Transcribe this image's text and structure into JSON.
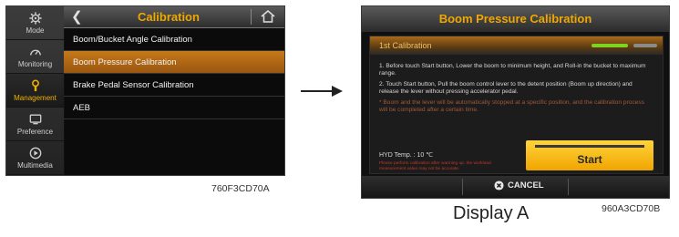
{
  "left": {
    "sidebar": [
      {
        "label": "Mode",
        "icon": "gear-icon",
        "active": false
      },
      {
        "label": "Monitoring",
        "icon": "gauge-icon",
        "active": false
      },
      {
        "label": "Management",
        "icon": "wrench-icon",
        "active": true
      },
      {
        "label": "Preference",
        "icon": "monitor-icon",
        "active": false
      },
      {
        "label": "Multimedia",
        "icon": "play-icon",
        "active": false
      }
    ],
    "header": {
      "title": "Calibration",
      "back_icon": "back-icon",
      "home_icon": "home-icon"
    },
    "menu": [
      {
        "label": "Boom/Bucket Angle Calibration",
        "selected": false
      },
      {
        "label": "Boom Pressure Calibration",
        "selected": true
      },
      {
        "label": "Brake Pedal Sensor Calibration",
        "selected": false
      },
      {
        "label": "AEB",
        "selected": false
      }
    ],
    "caption": "760F3CD70A"
  },
  "right": {
    "title": "Boom Pressure Calibration",
    "step_label": "1st Calibration",
    "progress": {
      "done": 1,
      "total": 2
    },
    "instructions": [
      "1. Before touch Start button, Lower the boom to minimum height, and Roll-in the bucket to maximum range.",
      "2. Touch Start button, Pull the boom control lever to the detent position (Boom up direction) and release the lever without pressing accelerator pedal.",
      "* Boom and the lever will be automatically stopped at a specific position, and the calibration process will be completed after a certain time."
    ],
    "hyd_temp": "HYD Temp. : 10 ℃",
    "warning": "Please perform calibration after warming up. the workload measurement value may not be accurate.",
    "start_label": "Start",
    "cancel_label": "CANCEL",
    "caption": "960A3CD70B",
    "display_label": "Display A"
  },
  "colors": {
    "accent": "#f0a800",
    "selected_row": "#b36a16",
    "progress_done": "#7ed321",
    "start_button": "#ffc41f"
  }
}
